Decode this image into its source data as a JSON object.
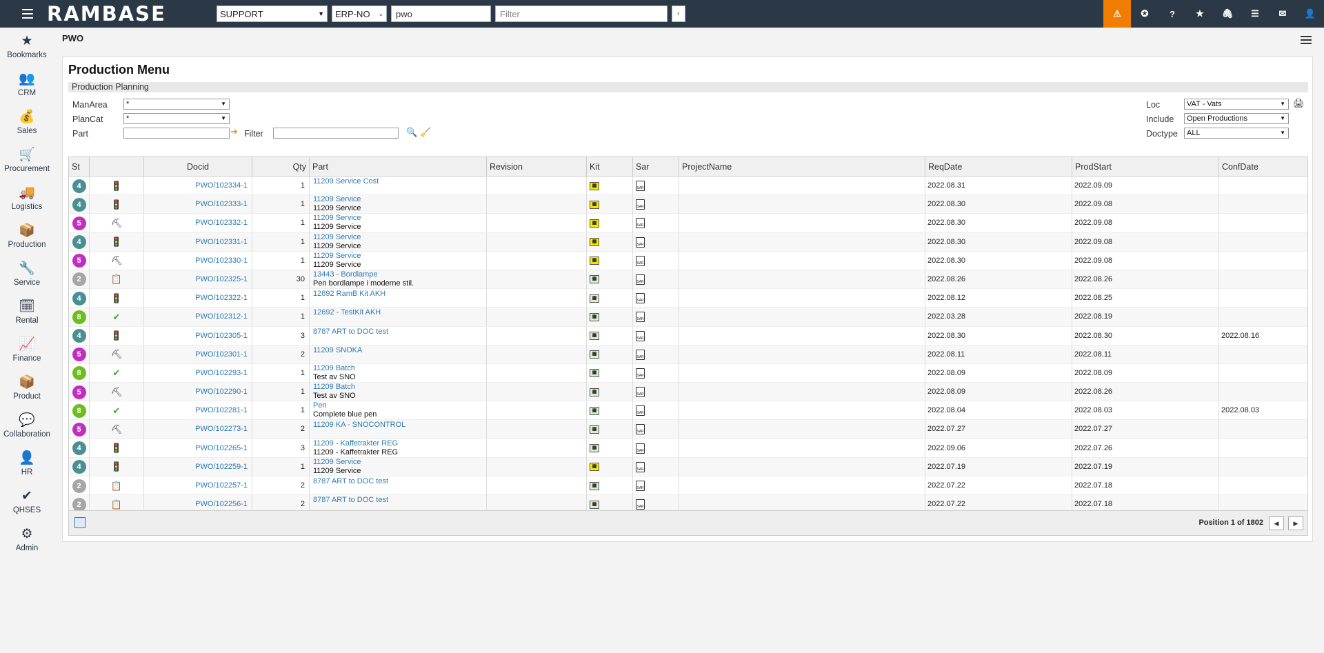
{
  "topbar": {
    "logo": "RAMBASE",
    "company": "SUPPORT",
    "database": "ERP-NO",
    "command": "pwo",
    "filter_placeholder": "Filter",
    "collapse": "‹",
    "icons": [
      "alert-icon",
      "task-icon",
      "help-icon",
      "bookmark-star-icon",
      "attachment-icon",
      "list-icon",
      "mail-icon",
      "user-icon"
    ]
  },
  "leftnav": [
    {
      "label": "Bookmarks",
      "icon": "★"
    },
    {
      "label": "CRM",
      "icon": "👥"
    },
    {
      "label": "Sales",
      "icon": "💰"
    },
    {
      "label": "Procurement",
      "icon": "🛒"
    },
    {
      "label": "Logistics",
      "icon": "🚚"
    },
    {
      "label": "Production",
      "icon": "📦"
    },
    {
      "label": "Service",
      "icon": "🔧"
    },
    {
      "label": "Rental",
      "icon": "🗓"
    },
    {
      "label": "Finance",
      "icon": "📈"
    },
    {
      "label": "Product",
      "icon": "📦"
    },
    {
      "label": "Collaboration",
      "icon": "💬"
    },
    {
      "label": "HR",
      "icon": "👤"
    },
    {
      "label": "QHSES",
      "icon": "✔"
    },
    {
      "label": "Admin",
      "icon": "⚙"
    }
  ],
  "page": {
    "title": "PWO",
    "menu_title": "Production Menu",
    "section": "Production Planning"
  },
  "filters": {
    "manarea_label": "ManArea",
    "manarea_value": "*",
    "plancat_label": "PlanCat",
    "plancat_value": "*",
    "part_label": "Part",
    "part_value": "",
    "filter_label": "Filter",
    "filter_value": "",
    "loc_label": "Loc",
    "loc_value": "VAT - Vats",
    "include_label": "Include",
    "include_value": "Open Productions",
    "doctype_label": "Doctype",
    "doctype_value": "ALL"
  },
  "grid": {
    "columns": [
      "St",
      "",
      "Docid",
      "Qty",
      "Part",
      "Revision",
      "Kit",
      "Sar",
      "ProjectName",
      "ReqDate",
      "ProdStart",
      "ConfDate"
    ],
    "status_colors": {
      "2": "#a6a6a6",
      "4": "#4b8f93",
      "5": "#c02fbf",
      "8": "#6cbe1c"
    },
    "rows": [
      {
        "st": "4",
        "icon": "traffic-light-icon",
        "docid": "PWO/102334-1",
        "qty": "1",
        "part": "11209 Service Cost",
        "desc": "",
        "kit": "yellow",
        "req": "2022.08.31",
        "prod": "2022.09.09",
        "conf": ""
      },
      {
        "st": "4",
        "icon": "traffic-light-icon",
        "docid": "PWO/102333-1",
        "qty": "1",
        "part": "11209 Service",
        "desc": "11209 Service",
        "kit": "yellow",
        "req": "2022.08.30",
        "prod": "2022.09.08",
        "conf": ""
      },
      {
        "st": "5",
        "icon": "worker-icon",
        "docid": "PWO/102332-1",
        "qty": "1",
        "part": "11209 Service",
        "desc": "11209 Service",
        "kit": "yellow",
        "req": "2022.08.30",
        "prod": "2022.09.08",
        "conf": ""
      },
      {
        "st": "4",
        "icon": "traffic-light-icon",
        "docid": "PWO/102331-1",
        "qty": "1",
        "part": "11209 Service",
        "desc": "11209 Service",
        "kit": "yellow",
        "req": "2022.08.30",
        "prod": "2022.09.08",
        "conf": ""
      },
      {
        "st": "5",
        "icon": "worker-icon",
        "docid": "PWO/102330-1",
        "qty": "1",
        "part": "11209 Service",
        "desc": "11209 Service",
        "kit": "yellow",
        "req": "2022.08.30",
        "prod": "2022.09.08",
        "conf": ""
      },
      {
        "st": "2",
        "icon": "clipboard-icon",
        "docid": "PWO/102325-1",
        "qty": "30",
        "part": "13443 - Bordlampe",
        "desc": "Pen bordlampe i moderne stil.",
        "kit": "green",
        "req": "2022.08.26",
        "prod": "2022.08.26",
        "conf": ""
      },
      {
        "st": "4",
        "icon": "traffic-light-icon",
        "docid": "PWO/102322-1",
        "qty": "1",
        "part": "12692 RamB Kit AKH",
        "desc": "",
        "kit": "green",
        "req": "2022.08.12",
        "prod": "2022.08.25",
        "conf": ""
      },
      {
        "st": "8",
        "icon": "check-icon",
        "docid": "PWO/102312-1",
        "qty": "1",
        "part": "12692 - TestKit AKH",
        "desc": "",
        "kit": "green",
        "req": "2022.03.28",
        "prod": "2022.08.19",
        "conf": ""
      },
      {
        "st": "4",
        "icon": "traffic-light-icon",
        "docid": "PWO/102305-1",
        "qty": "3",
        "part": "8787 ART to DOC test",
        "desc": "",
        "kit": "green",
        "req": "2022.08.30",
        "prod": "2022.08.30",
        "conf": "2022.08.16"
      },
      {
        "st": "5",
        "icon": "worker-icon",
        "docid": "PWO/102301-1",
        "qty": "2",
        "part": "11209 SNOKA",
        "desc": "",
        "kit": "green",
        "req": "2022.08.11",
        "prod": "2022.08.11",
        "conf": ""
      },
      {
        "st": "8",
        "icon": "check-icon",
        "docid": "PWO/102293-1",
        "qty": "1",
        "part": "11209 Batch",
        "desc": "Test av SNO",
        "kit": "green",
        "req": "2022.08.09",
        "prod": "2022.08.09",
        "conf": ""
      },
      {
        "st": "5",
        "icon": "worker-icon",
        "docid": "PWO/102290-1",
        "qty": "1",
        "part": "11209 Batch",
        "desc": "Test av SNO",
        "kit": "green",
        "req": "2022.08.09",
        "prod": "2022.08.26",
        "conf": ""
      },
      {
        "st": "8",
        "icon": "check-icon",
        "docid": "PWO/102281-1",
        "qty": "1",
        "part": "Pen",
        "desc": "Complete blue pen",
        "kit": "green",
        "req": "2022.08.04",
        "prod": "2022.08.03",
        "conf": "2022.08.03"
      },
      {
        "st": "5",
        "icon": "worker-icon",
        "docid": "PWO/102273-1",
        "qty": "2",
        "part": "11209 KA - SNOCONTROL",
        "desc": "",
        "kit": "green",
        "req": "2022.07.27",
        "prod": "2022.07.27",
        "conf": ""
      },
      {
        "st": "4",
        "icon": "traffic-light-icon",
        "docid": "PWO/102265-1",
        "qty": "3",
        "part": "11209 - Kaffetrakter REG",
        "desc": "11209 - Kaffetrakter REG",
        "kit": "green",
        "req": "2022.09.06",
        "prod": "2022.07.26",
        "conf": ""
      },
      {
        "st": "4",
        "icon": "traffic-light-icon",
        "docid": "PWO/102259-1",
        "qty": "1",
        "part": "11209 Service",
        "desc": "11209 Service",
        "kit": "yellow",
        "req": "2022.07.19",
        "prod": "2022.07.19",
        "conf": ""
      },
      {
        "st": "2",
        "icon": "clipboard-icon",
        "docid": "PWO/102257-1",
        "qty": "2",
        "part": "8787 ART to DOC test",
        "desc": "",
        "kit": "green",
        "req": "2022.07.22",
        "prod": "2022.07.18",
        "conf": ""
      },
      {
        "st": "2",
        "icon": "clipboard-icon",
        "docid": "PWO/102256-1",
        "qty": "2",
        "part": "8787 ART to DOC test",
        "desc": "",
        "kit": "green",
        "req": "2022.07.22",
        "prod": "2022.07.18",
        "conf": ""
      }
    ],
    "position_text": "Position 1 of 1802"
  }
}
